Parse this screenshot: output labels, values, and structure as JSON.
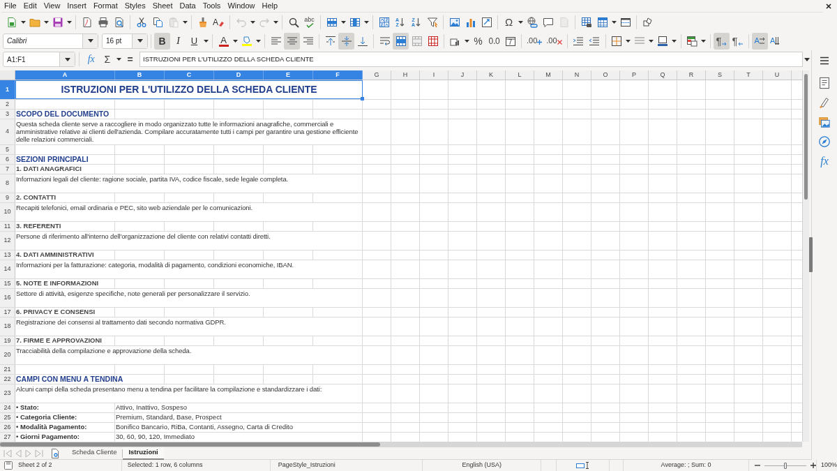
{
  "menu": [
    "File",
    "Edit",
    "View",
    "Insert",
    "Format",
    "Styles",
    "Sheet",
    "Data",
    "Tools",
    "Window",
    "Help"
  ],
  "standard_toolbar": {
    "groups": [
      [
        {
          "kind": "new",
          "dropdown": true,
          "disabled": false
        },
        {
          "kind": "open",
          "dropdown": true,
          "disabled": false
        },
        {
          "kind": "save",
          "dropdown": true,
          "disabled": false
        }
      ],
      [
        {
          "kind": "export-pdf",
          "dropdown": false,
          "disabled": false
        },
        {
          "kind": "print",
          "dropdown": false,
          "disabled": false
        },
        {
          "kind": "print-preview",
          "dropdown": false,
          "disabled": false
        }
      ],
      [
        {
          "kind": "cut",
          "dropdown": false,
          "disabled": false
        },
        {
          "kind": "copy",
          "dropdown": false,
          "disabled": false
        },
        {
          "kind": "paste",
          "dropdown": true,
          "disabled": true
        }
      ],
      [
        {
          "kind": "clone",
          "dropdown": false,
          "disabled": false
        },
        {
          "kind": "clear-formatting",
          "glyph": "A",
          "dropdown": false,
          "disabled": false
        }
      ],
      [
        {
          "kind": "undo",
          "dropdown": true,
          "disabled": true
        },
        {
          "kind": "redo",
          "dropdown": true,
          "disabled": true
        }
      ],
      [
        {
          "kind": "find",
          "dropdown": false,
          "disabled": false
        },
        {
          "kind": "spelling",
          "glyph": "abc",
          "dropdown": false,
          "disabled": false
        }
      ],
      [
        {
          "kind": "rows",
          "dropdown": true,
          "disabled": false
        },
        {
          "kind": "columns",
          "dropdown": true,
          "disabled": false
        }
      ],
      [
        {
          "kind": "sort",
          "dropdown": false,
          "disabled": false
        },
        {
          "kind": "sort-ascending",
          "glyph": "AZ",
          "dropdown": false,
          "disabled": false
        },
        {
          "kind": "sort-descending",
          "glyph": "ZA",
          "dropdown": false,
          "disabled": false
        },
        {
          "kind": "autofilter",
          "dropdown": false,
          "disabled": false
        }
      ],
      [
        {
          "kind": "image",
          "dropdown": false,
          "disabled": false
        },
        {
          "kind": "chart",
          "dropdown": false,
          "disabled": false
        },
        {
          "kind": "pivot",
          "dropdown": false,
          "disabled": false
        }
      ],
      [
        {
          "kind": "special-character",
          "glyph": "Ω",
          "dropdown": true,
          "disabled": false
        },
        {
          "kind": "hyperlink",
          "dropdown": false,
          "disabled": false
        },
        {
          "kind": "comment",
          "dropdown": false,
          "disabled": false
        },
        {
          "kind": "header-footer",
          "dropdown": false,
          "disabled": true
        }
      ],
      [
        {
          "kind": "print-area",
          "dropdown": false,
          "disabled": false
        },
        {
          "kind": "freeze",
          "dropdown": true,
          "disabled": false
        },
        {
          "kind": "split",
          "dropdown": false,
          "disabled": false
        }
      ],
      [
        {
          "kind": "draw",
          "dropdown": false,
          "disabled": false
        }
      ]
    ]
  },
  "formatting_toolbar": {
    "font_name": "Calibri",
    "font_size": "16 pt",
    "groups": [
      [
        {
          "kind": "bold",
          "glyph": "B",
          "pressed": true,
          "dropdown": false
        },
        {
          "kind": "italic",
          "glyph": "I",
          "pressed": false,
          "dropdown": false
        },
        {
          "kind": "underline",
          "glyph": "U",
          "pressed": false,
          "dropdown": true
        }
      ],
      [
        {
          "kind": "font-color",
          "glyph": "A",
          "pressed": false,
          "dropdown": true
        },
        {
          "kind": "highlight",
          "pressed": false,
          "dropdown": true
        }
      ],
      [
        {
          "kind": "align-left",
          "pressed": false,
          "dropdown": false
        },
        {
          "kind": "align-center",
          "pressed": true,
          "dropdown": false
        },
        {
          "kind": "align-right",
          "pressed": false,
          "dropdown": false
        }
      ],
      [
        {
          "kind": "align-top",
          "pressed": false,
          "dropdown": false
        },
        {
          "kind": "align-middle",
          "pressed": true,
          "dropdown": false
        },
        {
          "kind": "align-bottom",
          "pressed": false,
          "dropdown": false
        }
      ],
      [
        {
          "kind": "wrap-text",
          "pressed": false,
          "dropdown": false
        },
        {
          "kind": "merge-center",
          "pressed": true,
          "dropdown": false
        },
        {
          "kind": "merge-cells",
          "pressed": false,
          "dropdown": false
        },
        {
          "kind": "unmerge",
          "pressed": false,
          "dropdown": false
        }
      ],
      [
        {
          "kind": "number-format",
          "pressed": false,
          "dropdown": true
        },
        {
          "kind": "percent",
          "glyph": "%",
          "pressed": false,
          "dropdown": false
        },
        {
          "kind": "number",
          "glyph": "0.0",
          "pressed": false,
          "dropdown": false
        },
        {
          "kind": "date",
          "glyph": "7",
          "pressed": false,
          "dropdown": false
        }
      ],
      [
        {
          "kind": "add-decimal",
          "glyph": ".00",
          "pressed": false,
          "dropdown": false
        },
        {
          "kind": "delete-decimal",
          "glyph": ".00",
          "pressed": false,
          "dropdown": false
        }
      ],
      [
        {
          "kind": "indent",
          "pressed": false,
          "dropdown": false
        },
        {
          "kind": "outdent",
          "pressed": false,
          "dropdown": false
        }
      ],
      [
        {
          "kind": "borders",
          "pressed": false,
          "dropdown": true
        },
        {
          "kind": "border-style",
          "pressed": false,
          "dropdown": true
        },
        {
          "kind": "border-color",
          "pressed": false,
          "dropdown": true
        }
      ],
      [
        {
          "kind": "conditional",
          "pressed": false,
          "dropdown": true
        }
      ],
      [
        {
          "kind": "ltr",
          "glyph": "¶",
          "pressed": true,
          "dropdown": false
        },
        {
          "kind": "rtl",
          "glyph": "¶",
          "pressed": false,
          "dropdown": false
        }
      ],
      [
        {
          "kind": "text-lr",
          "glyph": "A",
          "pressed": true,
          "dropdown": false
        },
        {
          "kind": "text-tb",
          "glyph": "A",
          "pressed": false,
          "dropdown": false
        }
      ]
    ]
  },
  "formula_bar": {
    "name_box": "A1:F1",
    "buttons": [
      {
        "kind": "function-wizard",
        "glyph": "fx",
        "dropdown": false
      },
      {
        "kind": "sum",
        "glyph": "Σ",
        "dropdown": true
      },
      {
        "kind": "formula",
        "glyph": "=",
        "dropdown": false
      }
    ],
    "content": "ISTRUZIONI PER L'UTILIZZO DELLA SCHEDA CLIENTE"
  },
  "sidebar": [
    {
      "kind": "properties"
    },
    {
      "kind": "styles"
    },
    {
      "kind": "gallery"
    },
    {
      "kind": "navigator"
    },
    {
      "kind": "functions",
      "glyph": "fx"
    }
  ],
  "columns": [
    {
      "label": "A",
      "selected": true
    },
    {
      "label": "B",
      "selected": true
    },
    {
      "label": "C",
      "selected": true
    },
    {
      "label": "D",
      "selected": true
    },
    {
      "label": "E",
      "selected": true
    },
    {
      "label": "F",
      "selected": true
    },
    {
      "label": "G",
      "selected": false
    },
    {
      "label": "H",
      "selected": false
    },
    {
      "label": "I",
      "selected": false
    },
    {
      "label": "J",
      "selected": false
    },
    {
      "label": "K",
      "selected": false
    },
    {
      "label": "L",
      "selected": false
    },
    {
      "label": "M",
      "selected": false
    },
    {
      "label": "N",
      "selected": false
    },
    {
      "label": "O",
      "selected": false
    },
    {
      "label": "P",
      "selected": false
    },
    {
      "label": "Q",
      "selected": false
    },
    {
      "label": "R",
      "selected": false
    },
    {
      "label": "S",
      "selected": false
    },
    {
      "label": "T",
      "selected": false
    },
    {
      "label": "U",
      "selected": false
    }
  ],
  "rows": [
    {
      "number": "1",
      "selected": true,
      "kind": "title",
      "text": "ISTRUZIONI PER L'UTILIZZO DELLA SCHEDA CLIENTE"
    },
    {
      "number": "2",
      "selected": false,
      "kind": "blank"
    },
    {
      "number": "3",
      "selected": false,
      "kind": "heading",
      "text": "SCOPO DEL DOCUMENTO"
    },
    {
      "number": "4",
      "selected": false,
      "kind": "text",
      "text": "Questa scheda cliente serve a raccogliere in modo organizzato tutte le informazioni anagrafiche, commerciali e amministrative relative ai clienti dell'azienda. Compilare accuratamente tutti i campi per garantire una gestione efficiente delle relazioni commerciali."
    },
    {
      "number": "5",
      "selected": false,
      "kind": "blank"
    },
    {
      "number": "6",
      "selected": false,
      "kind": "heading",
      "text": "SEZIONI PRINCIPALI"
    },
    {
      "number": "7",
      "selected": false,
      "kind": "subheading",
      "text": "1. DATI ANAGRAFICI"
    },
    {
      "number": "8",
      "selected": false,
      "kind": "text",
      "text": "Informazioni legali del cliente: ragione sociale, partita IVA, codice fiscale, sede legale completa."
    },
    {
      "number": "9",
      "selected": false,
      "kind": "subheading",
      "text": "2. CONTATTI"
    },
    {
      "number": "10",
      "selected": false,
      "kind": "text",
      "text": "Recapiti telefonici, email ordinaria e PEC, sito web aziendale per le comunicazioni."
    },
    {
      "number": "11",
      "selected": false,
      "kind": "subheading",
      "text": "3. REFERENTI"
    },
    {
      "number": "12",
      "selected": false,
      "kind": "text",
      "text": "Persone di riferimento all'interno dell'organizzazione del cliente con relativi contatti diretti."
    },
    {
      "number": "13",
      "selected": false,
      "kind": "subheading",
      "text": "4. DATI AMMINISTRATIVI"
    },
    {
      "number": "14",
      "selected": false,
      "kind": "text",
      "text": "Informazioni per la fatturazione: categoria, modalità di pagamento, condizioni economiche, IBAN."
    },
    {
      "number": "15",
      "selected": false,
      "kind": "subheading",
      "text": "5. NOTE E INFORMAZIONI"
    },
    {
      "number": "16",
      "selected": false,
      "kind": "text",
      "text": "Settore di attività, esigenze specifiche, note generali per personalizzare il servizio."
    },
    {
      "number": "17",
      "selected": false,
      "kind": "subheading",
      "text": "6. PRIVACY E CONSENSI"
    },
    {
      "number": "18",
      "selected": false,
      "kind": "text",
      "text": "Registrazione dei consensi al trattamento dati secondo normativa GDPR."
    },
    {
      "number": "19",
      "selected": false,
      "kind": "subheading",
      "text": "7. FIRME E APPROVAZIONI"
    },
    {
      "number": "20",
      "selected": false,
      "kind": "text",
      "text": "Tracciabilità della compilazione e approvazione della scheda."
    },
    {
      "number": "21",
      "selected": false,
      "kind": "blank"
    },
    {
      "number": "22",
      "selected": false,
      "kind": "heading",
      "text": "CAMPI CON MENU A TENDINA"
    },
    {
      "number": "23",
      "selected": false,
      "kind": "text",
      "text": "Alcuni campi della scheda presentano menu a tendina per facilitare la compilazione e standardizzare i dati:"
    },
    {
      "number": "24",
      "selected": false,
      "kind": "field",
      "label": "• Stato:",
      "value": "Attivo, Inattivo, Sospeso"
    },
    {
      "number": "25",
      "selected": false,
      "kind": "field",
      "label": "• Categoria Cliente:",
      "value": "Premium, Standard, Base, Prospect"
    },
    {
      "number": "26",
      "selected": false,
      "kind": "field",
      "label": "• Modalità Pagamento:",
      "value": "Bonifico Bancario, RiBa, Contanti, Assegno, Carta di Credito"
    },
    {
      "number": "27",
      "selected": false,
      "kind": "field",
      "label": "• Giorni Pagamento:",
      "value": "30, 60, 90, 120, Immediato"
    }
  ],
  "sheet_tabs": [
    {
      "label": "Scheda Cliente",
      "selected": false
    },
    {
      "label": "Istruzioni",
      "selected": true
    }
  ],
  "status_bar": {
    "sheet": "Sheet 2 of 2",
    "selection": "Selected: 1 row, 6 columns",
    "page_style": "PageStyle_Istruzioni",
    "language": "English (USA)",
    "summary": "Average: ; Sum: 0",
    "zoom_slider": {
      "level": 0.5
    },
    "zoom": "100%"
  }
}
